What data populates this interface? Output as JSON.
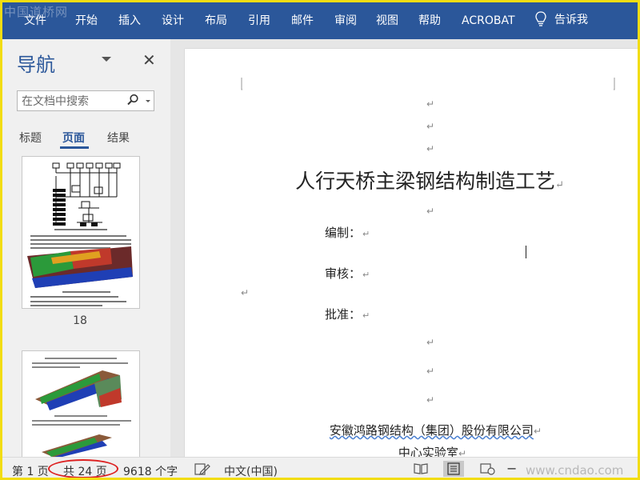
{
  "watermark_top": "中国道桥网",
  "ribbon": {
    "items": [
      "文件",
      "开始",
      "插入",
      "设计",
      "布局",
      "引用",
      "邮件",
      "审阅",
      "视图",
      "帮助",
      "ACROBAT"
    ],
    "tell_me": "告诉我"
  },
  "nav": {
    "title": "导航",
    "search_placeholder": "在文档中搜索",
    "tabs": [
      "标题",
      "页面",
      "结果"
    ],
    "active_tab": "页面",
    "thumbnails": [
      {
        "page_number": "18"
      }
    ]
  },
  "document": {
    "title": "人行天桥主梁钢结构制造工艺",
    "fields": [
      "编制：",
      "审核：",
      "批准："
    ],
    "organization": "安徽鸿路钢结构（集团）股份有限公司",
    "lab": "中心实验室",
    "paragraph_mark": "↵"
  },
  "status": {
    "page": "第 1 页",
    "total": "共 24 页",
    "words": "9618 个字",
    "language": "中文(中国)",
    "watermark": "www.cndao.com"
  },
  "colors": {
    "ribbon": "#2b579a",
    "frame": "#f2dd12",
    "highlight": "#dd2222"
  }
}
